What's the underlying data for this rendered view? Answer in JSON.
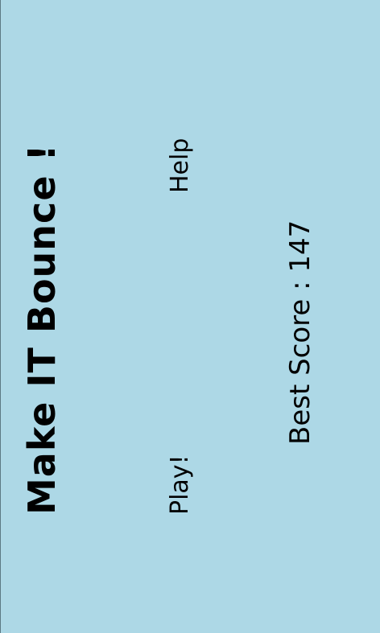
{
  "game": {
    "title": "Make IT Bounce !",
    "menu": {
      "play_label": "Play!",
      "help_label": "Help"
    },
    "best_score": {
      "label": "Best Score",
      "separator": " : ",
      "value": "147"
    }
  },
  "colors": {
    "background": "#add8e6",
    "text": "#000000"
  }
}
